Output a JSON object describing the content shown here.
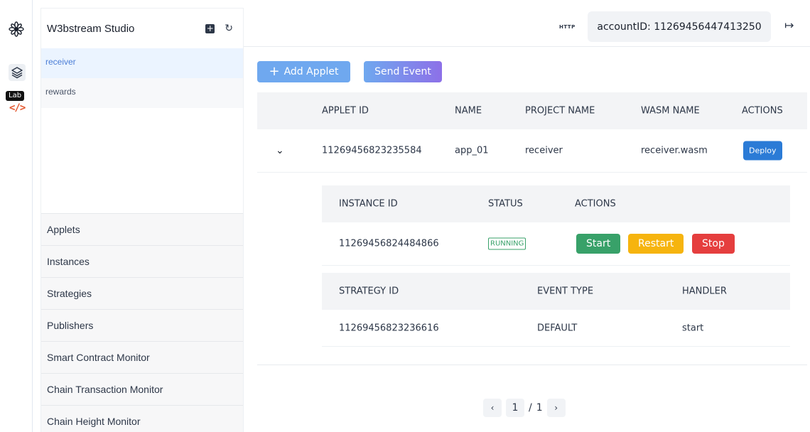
{
  "rail": {
    "lab_label": "Lab",
    "icons": [
      "flower-logo-icon",
      "layers-icon",
      "code-icon"
    ]
  },
  "sidebar": {
    "title": "W3bstream Studio",
    "projects": [
      {
        "label": "receiver",
        "active": true
      },
      {
        "label": "rewards",
        "active": false
      }
    ],
    "nav": [
      {
        "label": "Applets"
      },
      {
        "label": "Instances"
      },
      {
        "label": "Strategies"
      },
      {
        "label": "Publishers"
      },
      {
        "label": "Smart Contract Monitor"
      },
      {
        "label": "Chain Transaction Monitor"
      },
      {
        "label": "Chain Height Monitor"
      }
    ]
  },
  "header": {
    "protocol": "HTTP",
    "account": "accountID: 11269456447413250"
  },
  "toolbar": {
    "add_applet": "Add Applet",
    "send_event": "Send Event"
  },
  "applets": {
    "columns": [
      "APPLET ID",
      "NAME",
      "PROJECT NAME",
      "WASM NAME",
      "ACTIONS"
    ],
    "rows": [
      {
        "id": "11269456823235584",
        "name": "app_01",
        "project": "receiver",
        "wasm": "receiver.wasm",
        "action": "Deploy"
      }
    ]
  },
  "instances": {
    "columns": [
      "INSTANCE ID",
      "STATUS",
      "ACTIONS"
    ],
    "rows": [
      {
        "id": "11269456824484866",
        "status": "RUNNING",
        "start": "Start",
        "restart": "Restart",
        "stop": "Stop"
      }
    ]
  },
  "strategies": {
    "columns": [
      "STRATEGY ID",
      "EVENT TYPE",
      "HANDLER"
    ],
    "rows": [
      {
        "id": "11269456823236616",
        "event_type": "DEFAULT",
        "handler": "start"
      }
    ]
  },
  "pagination": {
    "current": "1",
    "separator": "/",
    "total": "1"
  },
  "colors": {
    "primary": "#6fa8ef",
    "deploy": "#2b7bd6",
    "start": "#38a169",
    "restart": "#f6b40e",
    "stop": "#e53e3e"
  }
}
